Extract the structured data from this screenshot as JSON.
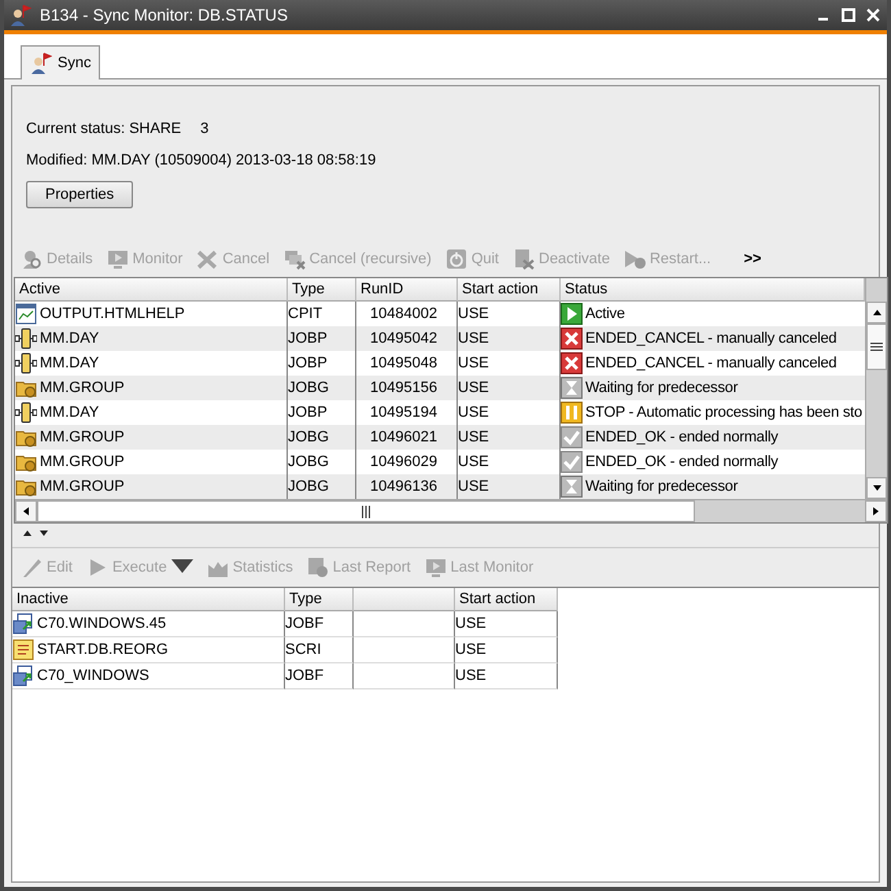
{
  "window": {
    "title": "B134 - Sync Monitor: DB.STATUS"
  },
  "tabs": [
    {
      "label": "Sync",
      "selected": true
    }
  ],
  "status": {
    "current_label": "Current status: SHARE",
    "current_value": "3",
    "modified": "Modified: MM.DAY (10509004) 2013-03-18 08:58:19"
  },
  "properties_button": "Properties",
  "active_toolbar": {
    "items": [
      {
        "kind": "details",
        "label": "Details",
        "disabled": true
      },
      {
        "kind": "monitor",
        "label": "Monitor",
        "disabled": true
      },
      {
        "kind": "cancel",
        "label": "Cancel",
        "disabled": true
      },
      {
        "kind": "cancel_recursive",
        "label": "Cancel (recursive)",
        "disabled": true
      },
      {
        "kind": "quit",
        "label": "Quit",
        "disabled": true
      },
      {
        "kind": "deactivate",
        "label": "Deactivate",
        "disabled": true
      },
      {
        "kind": "restart",
        "label": "Restart...",
        "disabled": true
      }
    ],
    "overflow": ">>"
  },
  "active_table": {
    "columns": [
      "Active",
      "Type",
      "RunID",
      "Start action",
      "Status"
    ],
    "rows": [
      {
        "kind": "cpit",
        "name": "OUTPUT.HTMLHELP",
        "type": "CPIT",
        "run_id": "10484002",
        "start_action": "USE",
        "status": {
          "kind": "active",
          "text": "Active"
        }
      },
      {
        "kind": "jobp",
        "name": "MM.DAY",
        "type": "JOBP",
        "run_id": "10495042",
        "start_action": "USE",
        "status": {
          "kind": "canceled",
          "text": "ENDED_CANCEL - manually canceled"
        }
      },
      {
        "kind": "jobp",
        "name": "MM.DAY",
        "type": "JOBP",
        "run_id": "10495048",
        "start_action": "USE",
        "status": {
          "kind": "canceled",
          "text": "ENDED_CANCEL - manually canceled"
        }
      },
      {
        "kind": "jobg",
        "name": "MM.GROUP",
        "type": "JOBG",
        "run_id": "10495156",
        "start_action": "USE",
        "status": {
          "kind": "waiting",
          "text": "Waiting for predecessor"
        }
      },
      {
        "kind": "jobp",
        "name": "MM.DAY",
        "type": "JOBP",
        "run_id": "10495194",
        "start_action": "USE",
        "status": {
          "kind": "stop",
          "text": "STOP - Automatic processing has been sto"
        }
      },
      {
        "kind": "jobg",
        "name": "MM.GROUP",
        "type": "JOBG",
        "run_id": "10496021",
        "start_action": "USE",
        "status": {
          "kind": "ok",
          "text": "ENDED_OK - ended normally"
        }
      },
      {
        "kind": "jobg",
        "name": "MM.GROUP",
        "type": "JOBG",
        "run_id": "10496029",
        "start_action": "USE",
        "status": {
          "kind": "ok",
          "text": "ENDED_OK - ended normally"
        }
      },
      {
        "kind": "jobg",
        "name": "MM.GROUP",
        "type": "JOBG",
        "run_id": "10496136",
        "start_action": "USE",
        "status": {
          "kind": "waiting",
          "text": "Waiting for predecessor"
        }
      }
    ]
  },
  "inactive_toolbar": {
    "items": [
      {
        "kind": "edit",
        "label": "Edit",
        "disabled": true
      },
      {
        "kind": "execute",
        "label": "Execute",
        "disabled": true,
        "dropdown": true
      },
      {
        "kind": "statistics",
        "label": "Statistics",
        "disabled": true
      },
      {
        "kind": "last_report",
        "label": "Last Report",
        "disabled": true
      },
      {
        "kind": "last_monitor",
        "label": "Last Monitor",
        "disabled": true
      }
    ]
  },
  "inactive_table": {
    "columns": [
      {
        "label": "Inactive"
      },
      {
        "label": "Type"
      },
      {},
      {
        "label": "Start action"
      }
    ],
    "rows": [
      {
        "kind": "jobf",
        "name": "C70.WINDOWS.45",
        "type": "JOBF",
        "start_action": "USE"
      },
      {
        "kind": "scri",
        "name": "START.DB.REORG",
        "type": "SCRI",
        "start_action": "USE"
      },
      {
        "kind": "jobf",
        "name": "C70_WINDOWS",
        "type": "JOBF",
        "start_action": "USE"
      }
    ]
  }
}
